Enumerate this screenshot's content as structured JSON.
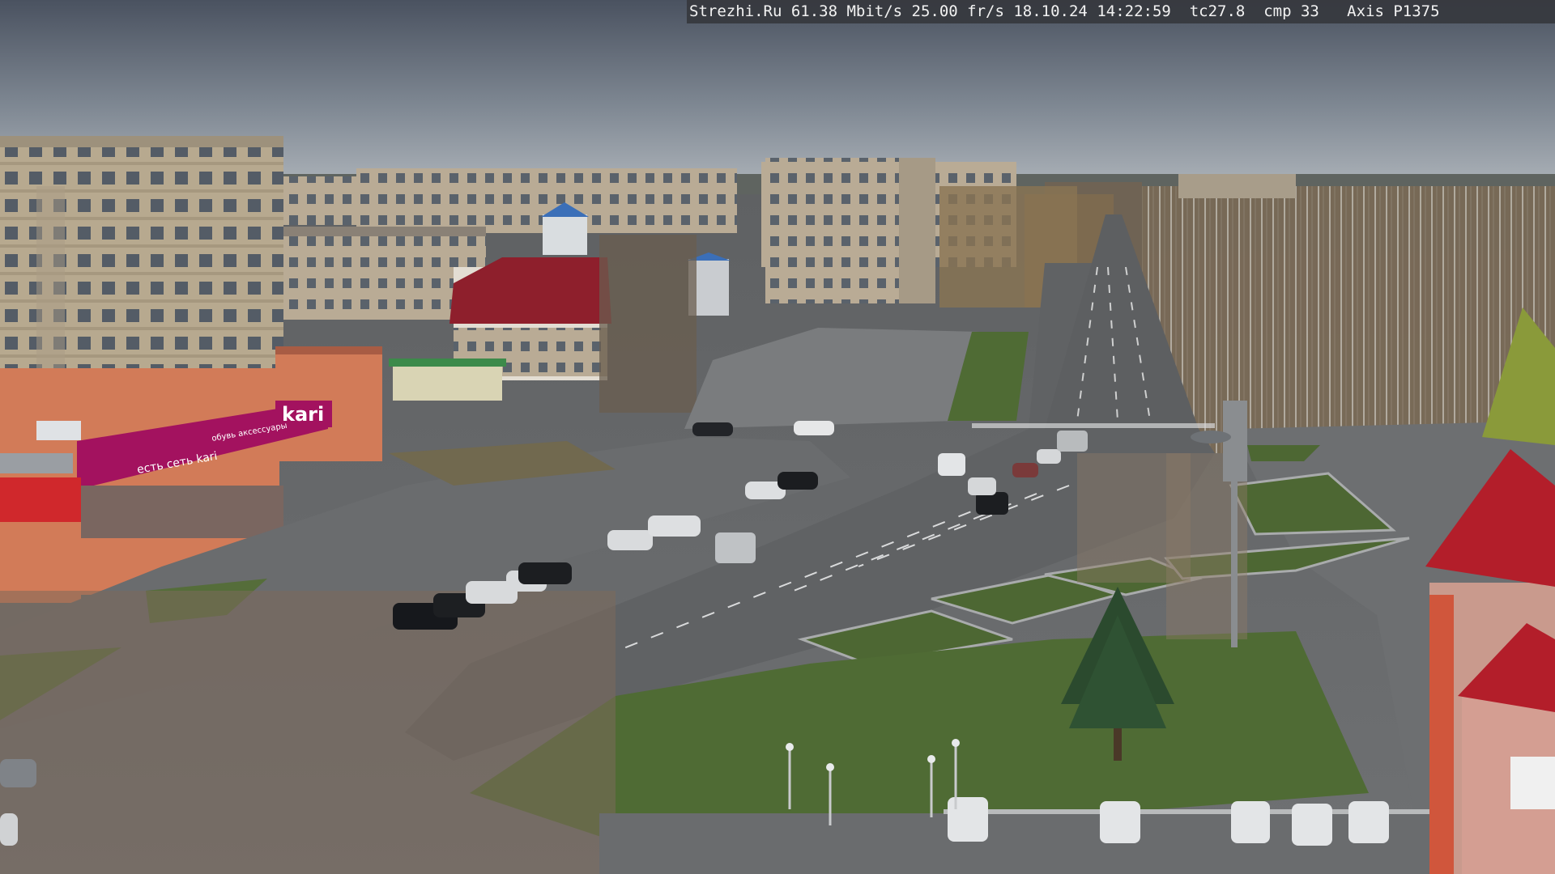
{
  "camera_overlay": {
    "text": "Strezhi.Ru 61.38 Mbit/s 25.00 fr/s 18.10.24 14:22:59  tc27.8  cmp 33   Axis P1375"
  },
  "signs": {
    "store_name": "kari",
    "store_slogan": "есть сеть kari",
    "store_sub": "обувь аксессуары"
  },
  "colors": {
    "sky_top": "#4a5260",
    "sky_bottom": "#a9b0b8",
    "road": "#6d6f71",
    "grass": "#4f6b34",
    "brand_magenta": "#a3125f",
    "roof_red": "#b31e2a"
  }
}
